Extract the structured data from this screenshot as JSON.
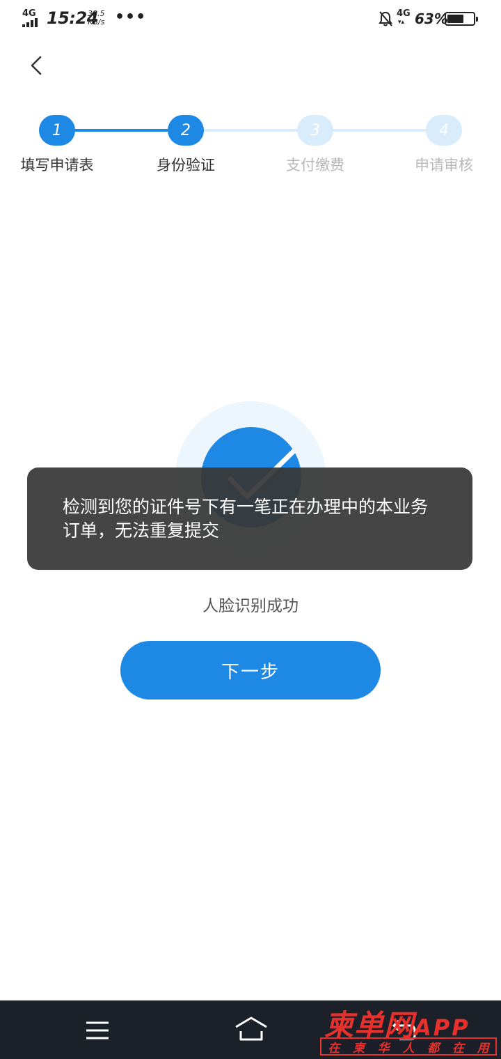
{
  "status_bar": {
    "network": "4G",
    "time": "15:24",
    "speed_value": "38.5",
    "speed_unit": "KB/s",
    "more": "•••",
    "network_right": "4G",
    "battery": "63%",
    "battery_level": 0.63
  },
  "steps": [
    {
      "number": "1",
      "label": "填写申请表",
      "state": "done"
    },
    {
      "number": "2",
      "label": "身份验证",
      "state": "active"
    },
    {
      "number": "3",
      "label": "支付缴费",
      "state": "pending"
    },
    {
      "number": "4",
      "label": "申请审核",
      "state": "pending"
    }
  ],
  "colors": {
    "primary": "#1e88e5",
    "pending": "#d9ecfb",
    "pending_text": "#b8b8b8",
    "active_text": "#333333"
  },
  "result": {
    "message": "人脸识别成功",
    "next_button": "下一步"
  },
  "toast": {
    "message": "检测到您的证件号下有一笔正在办理中的本业务订单，无法重复提交"
  },
  "watermark": {
    "title": "柬单网",
    "title_app": "APP",
    "subtitle_chars": [
      "在",
      "柬",
      "华",
      "人",
      "都",
      "在",
      "用"
    ]
  }
}
